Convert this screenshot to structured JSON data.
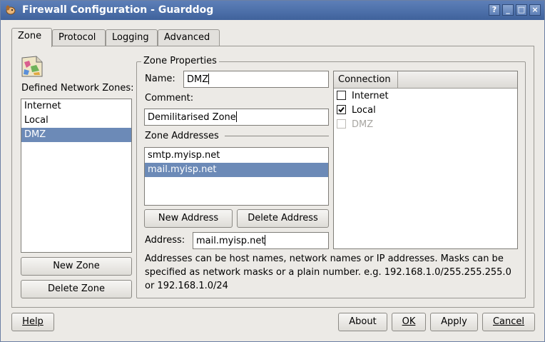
{
  "window": {
    "title": "Firewall Configuration - Guarddog",
    "help_btn": "?",
    "min_btn": "_",
    "max_btn": "□",
    "close_btn": "×"
  },
  "tabs": [
    {
      "label": "Zone"
    },
    {
      "label": "Protocol"
    },
    {
      "label": "Logging"
    },
    {
      "label": "Advanced"
    }
  ],
  "zones": {
    "label": "Defined Network Zones:",
    "items": [
      "Internet",
      "Local",
      "DMZ"
    ],
    "selected": "DMZ",
    "new_zone": "New Zone",
    "delete_zone": "Delete Zone"
  },
  "props": {
    "title": "Zone Properties",
    "name_label": "Name:",
    "name_value": "DMZ",
    "comment_label": "Comment:",
    "comment_value": "Demilitarised Zone",
    "addresses_label": "Zone Addresses",
    "addresses": [
      "smtp.myisp.net",
      "mail.myisp.net"
    ],
    "selected_address": "mail.myisp.net",
    "new_address": "New Address",
    "delete_address": "Delete Address",
    "address_label": "Address:",
    "address_value": "mail.myisp.net",
    "help_text": "Addresses can be host names, network names or IP addresses. Masks can be specified as network masks or a plain number. e.g. 192.168.1.0/255.255.255.0 or 192.168.1.0/24"
  },
  "connection": {
    "header": "Connection",
    "items": [
      {
        "label": "Internet",
        "checked": false,
        "enabled": true
      },
      {
        "label": "Local",
        "checked": true,
        "enabled": true
      },
      {
        "label": "DMZ",
        "checked": false,
        "enabled": false
      }
    ]
  },
  "footer": {
    "help": "Help",
    "about": "About",
    "ok": "OK",
    "apply": "Apply",
    "cancel": "Cancel"
  }
}
